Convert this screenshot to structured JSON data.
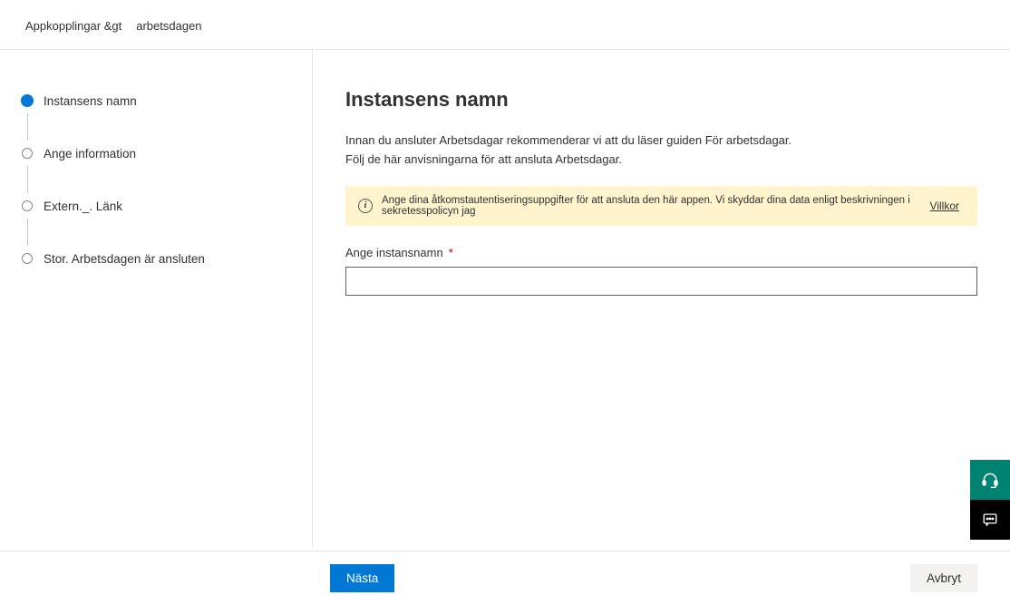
{
  "breadcrumb": {
    "item1": "Appkopplingar &gt",
    "item2": "arbetsdagen"
  },
  "steps": [
    {
      "label": "Instansens namn",
      "active": true
    },
    {
      "label": "Ange information",
      "active": false
    },
    {
      "label": "Extern._. Länk",
      "active": false
    },
    {
      "label": "Stor. Arbetsdagen är ansluten",
      "active": false
    }
  ],
  "main": {
    "title": "Instansens namn",
    "desc_line1": "Innan du ansluter Arbetsdagar rekommenderar vi att du läser guiden För arbetsdagar.",
    "desc_line2": "Följ de här anvisningarna för att ansluta Arbetsdagar.",
    "banner_text": "Ange dina åtkomstautentiseringsuppgifter för att ansluta den här appen. Vi skyddar dina data enligt beskrivningen i sekretesspolicyn jag",
    "banner_link": "Villkor",
    "field_label": "Ange instansnamn",
    "input_value": ""
  },
  "footer": {
    "next": "Nästa",
    "cancel": "Avbryt"
  }
}
